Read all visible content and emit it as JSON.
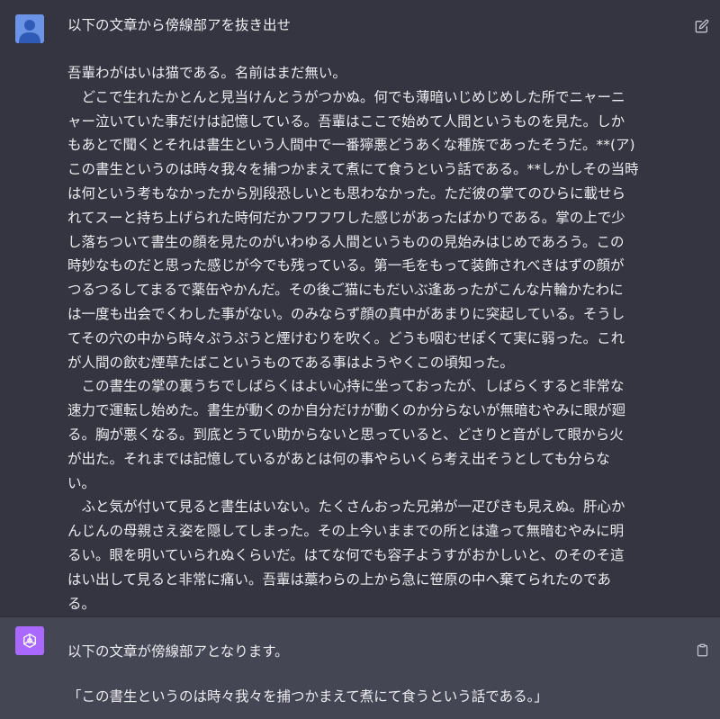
{
  "user_message": {
    "title": "以下の文章から傍線部アを抜き出せ",
    "lines": [
      "吾輩わがはいは猫である。名前はまだ無い。",
      "　どこで生れたかとんと見当けんとうがつかぬ。何でも薄暗いじめじめした所でニャーニ",
      "ャー泣いていた事だけは記憶している。吾輩はここで始めて人間というものを見た。しか",
      "もあとで聞くとそれは書生という人間中で一番獰悪どうあくな種族であったそうだ。**(ア)",
      "この書生というのは時々我々を捕つかまえて煮にて食うという話である。**しかしその当時",
      "は何という考もなかったから別段恐しいとも思わなかった。ただ彼の掌てのひらに載せら",
      "れてスーと持ち上げられた時何だかフワフワした感じがあったばかりである。掌の上で少",
      "し落ちついて書生の顔を見たのがいわゆる人間というものの見始みはじめであろう。この",
      "時妙なものだと思った感じが今でも残っている。第一毛をもって装飾されべきはずの顔が",
      "つるつるしてまるで薬缶やかんだ。その後ご猫にもだいぶ逢あったがこんな片輪かたわに",
      "は一度も出会でくわした事がない。のみならず顔の真中があまりに突起している。そうし",
      "てその穴の中から時々ぷうぷうと煙けむりを吹く。どうも咽むせぽくて実に弱った。これ",
      "が人間の飲む煙草たばこというものである事はようやくこの頃知った。",
      "　この書生の掌の裏うちでしばらくはよい心持に坐っておったが、しばらくすると非常な",
      "速力で運転し始めた。書生が動くのか自分だけが動くのか分らないが無暗むやみに眼が廻",
      "る。胸が悪くなる。到底とうてい助からないと思っていると、どさりと音がして眼から火",
      "が出た。それまでは記憶しているがあとは何の事やらいくら考え出そうとしても分らな",
      "い。",
      "　ふと気が付いて見ると書生はいない。たくさんおった兄弟が一疋ぴきも見えぬ。肝心か",
      "んじんの母親さえ姿を隠してしまった。その上今いままでの所とは違って無暗むやみに明",
      "るい。眼を明いていられぬくらいだ。はてな何でも容子ようすがおかしいと、のそのそ這",
      "はい出して見ると非常に痛い。吾輩は藁わらの上から急に笹原の中へ棄てられたのであ",
      "る。"
    ]
  },
  "assistant_message": {
    "title": "以下の文章が傍線部アとなります。",
    "answer": "「この書生というのは時々我々を捕つかまえて煮にて食うという話である。」"
  },
  "icons": {
    "user_avatar": "user-avatar-icon",
    "assistant_avatar": "openai-logo-icon",
    "edit": "edit-icon",
    "copy": "clipboard-icon"
  },
  "colors": {
    "background": "#343541",
    "assistant_background": "#444654",
    "user_avatar": "#6c94e6",
    "assistant_avatar": "#ab68ff",
    "text": "#ececf1"
  }
}
